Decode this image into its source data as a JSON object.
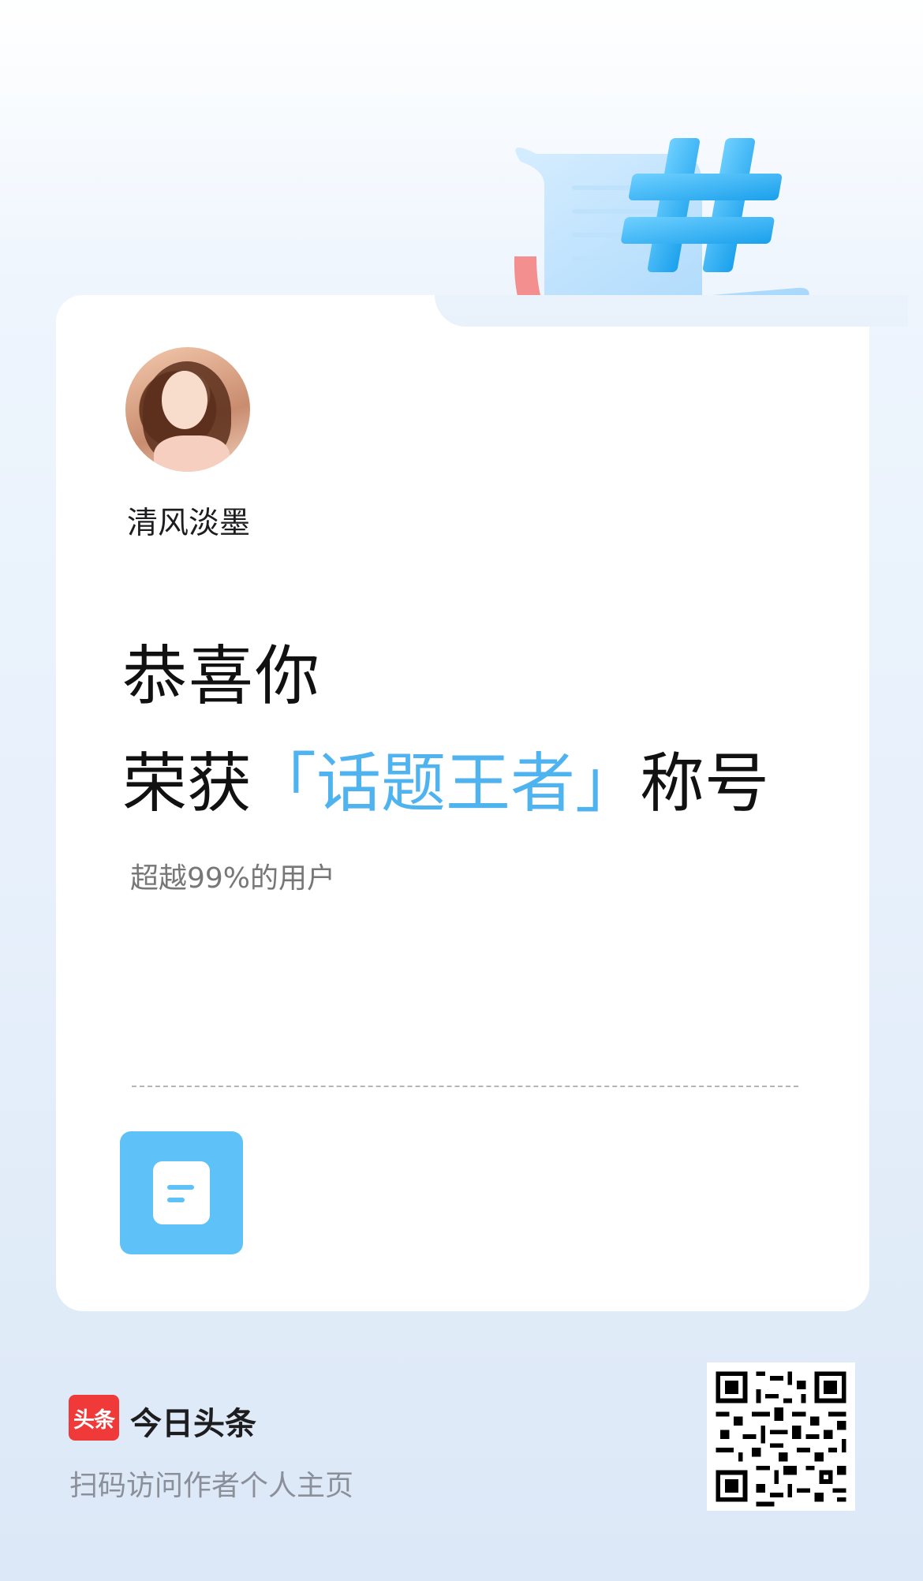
{
  "user": {
    "name": "清风淡墨"
  },
  "headline": {
    "line1": "恭喜你",
    "line2_prefix": "荣获",
    "title": "「话题王者」",
    "line2_suffix": "称号"
  },
  "stat": "超越99%的用户",
  "footer": {
    "logo_text": "头条",
    "brand": "今日头条",
    "caption": "扫码访问作者个人主页"
  },
  "colors": {
    "accent": "#4fb3f0",
    "badge": "#5ec1f8",
    "logo": "#f03a3a"
  },
  "icons": [
    "hashtag-icon",
    "document-icon",
    "qr-code"
  ]
}
